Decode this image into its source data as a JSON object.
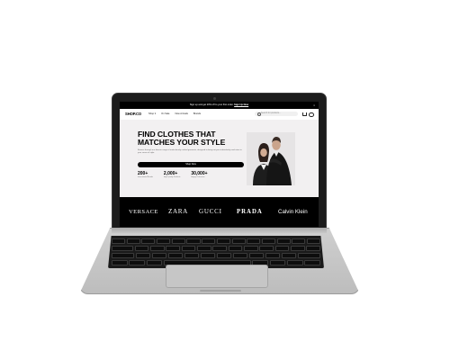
{
  "promo": {
    "text": "Sign up and get 20% off to your first order.",
    "link": "Sign Up Now",
    "close": "×"
  },
  "navbar": {
    "logo": "SHOP.CO",
    "links": [
      "Shop ▾",
      "On Sale",
      "New Arrivals",
      "Brands"
    ],
    "search_placeholder": "Search for products..."
  },
  "hero": {
    "title_line1": "FIND CLOTHES THAT",
    "title_line2": "MATCHES YOUR STYLE",
    "description": "Browse through our diverse range of meticulously crafted garments, designed to bring out your individuality and cater to your sense of style.",
    "button": "Shop Now",
    "stats": [
      {
        "value": "200+",
        "label": "International Brands"
      },
      {
        "value": "2,000+",
        "label": "High-Quality Products"
      },
      {
        "value": "30,000+",
        "label": "Happy Customers"
      }
    ]
  },
  "brands": [
    "VERSACE",
    "ZARA",
    "GUCCI",
    "PRADA",
    "Calvin Klein"
  ],
  "colors": {
    "accent": "#000000",
    "hero_background": "#f2f0f1",
    "laptop_body": "#c8c8c8",
    "bezel": "#1c1c1c"
  },
  "icons": [
    "search-icon",
    "cart-icon",
    "user-icon"
  ]
}
